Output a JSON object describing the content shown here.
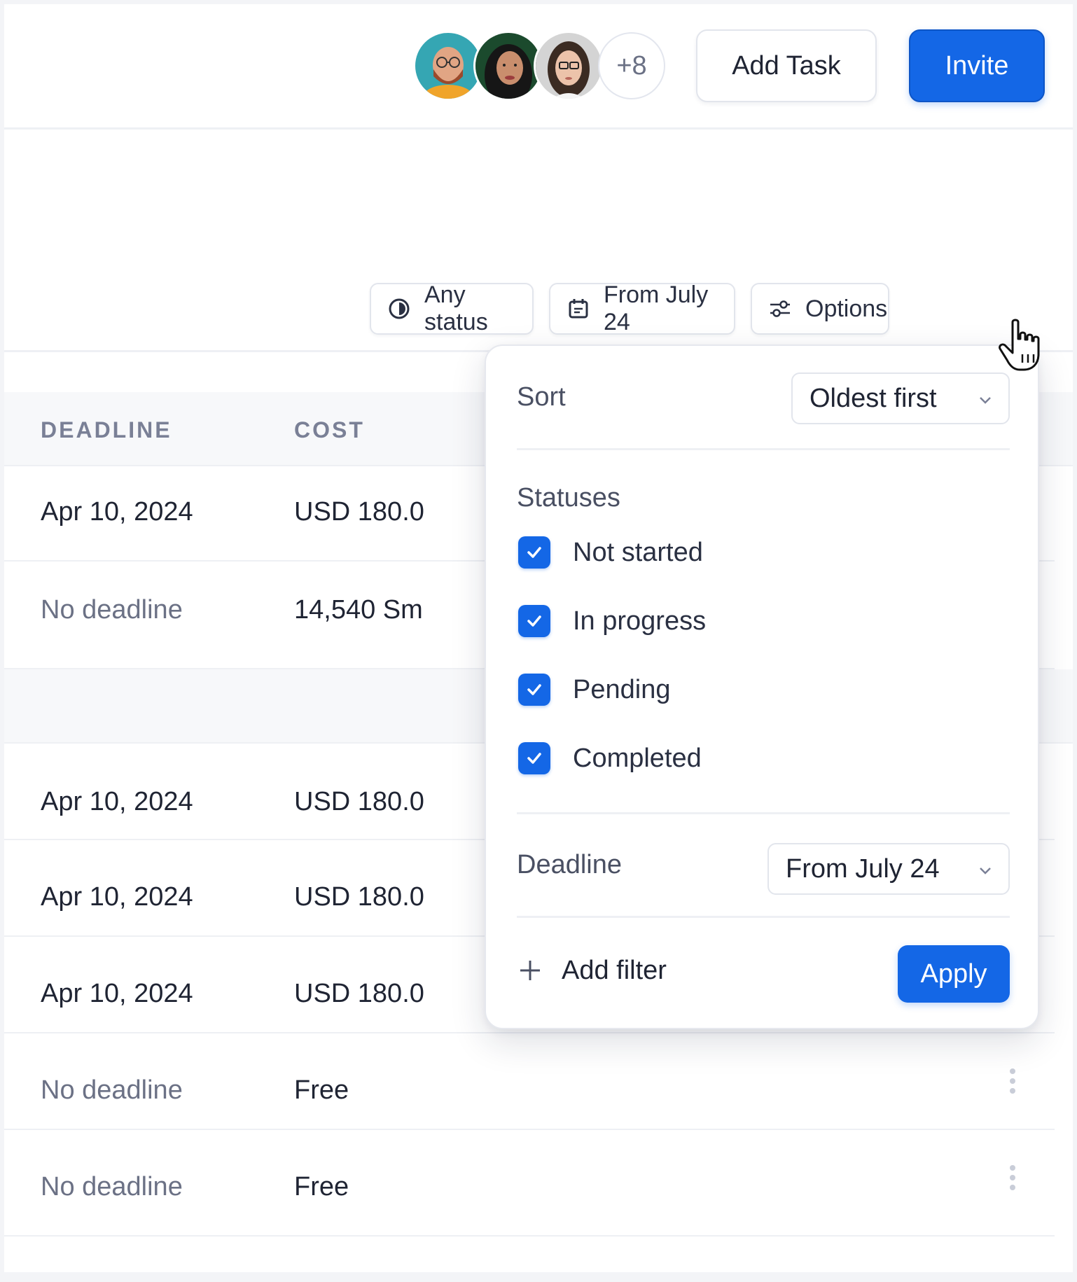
{
  "header": {
    "avatars": [
      {
        "name": "avatar-1",
        "bg": "#35a6b3"
      },
      {
        "name": "avatar-2",
        "bg": "#1b4a2d"
      },
      {
        "name": "avatar-3",
        "bg": "#cfcfcf"
      }
    ],
    "more_count": "+8",
    "add_task_label": "Add Task",
    "invite_label": "Invite"
  },
  "filters": {
    "status_label": "Any status",
    "date_label": "From July 24",
    "options_label": "Options"
  },
  "table": {
    "columns": [
      "DEADLINE",
      "COST"
    ],
    "rows": [
      {
        "deadline": "Apr 10, 2024",
        "cost": "USD 180.0"
      },
      {
        "deadline": "No deadline",
        "cost": "14,540 Sm"
      },
      {
        "deadline": "Apr 10, 2024",
        "cost": "USD 180.0"
      },
      {
        "deadline": "Apr 10, 2024",
        "cost": "USD 180.0"
      },
      {
        "deadline": "Apr 10, 2024",
        "cost": "USD 180.0"
      },
      {
        "deadline": "No deadline",
        "cost": "Free"
      },
      {
        "deadline": "No deadline",
        "cost": "Free"
      }
    ]
  },
  "popover": {
    "sort_label": "Sort",
    "sort_value": "Oldest first",
    "statuses_label": "Statuses",
    "statuses": [
      {
        "label": "Not started",
        "checked": true
      },
      {
        "label": "In progress",
        "checked": true
      },
      {
        "label": "Pending",
        "checked": true
      },
      {
        "label": "Completed",
        "checked": true
      }
    ],
    "deadline_label": "Deadline",
    "deadline_value": "From July 24",
    "add_filter_label": "Add filter",
    "apply_label": "Apply"
  },
  "colors": {
    "accent": "#1467e6",
    "muted_text": "#6b7185"
  }
}
